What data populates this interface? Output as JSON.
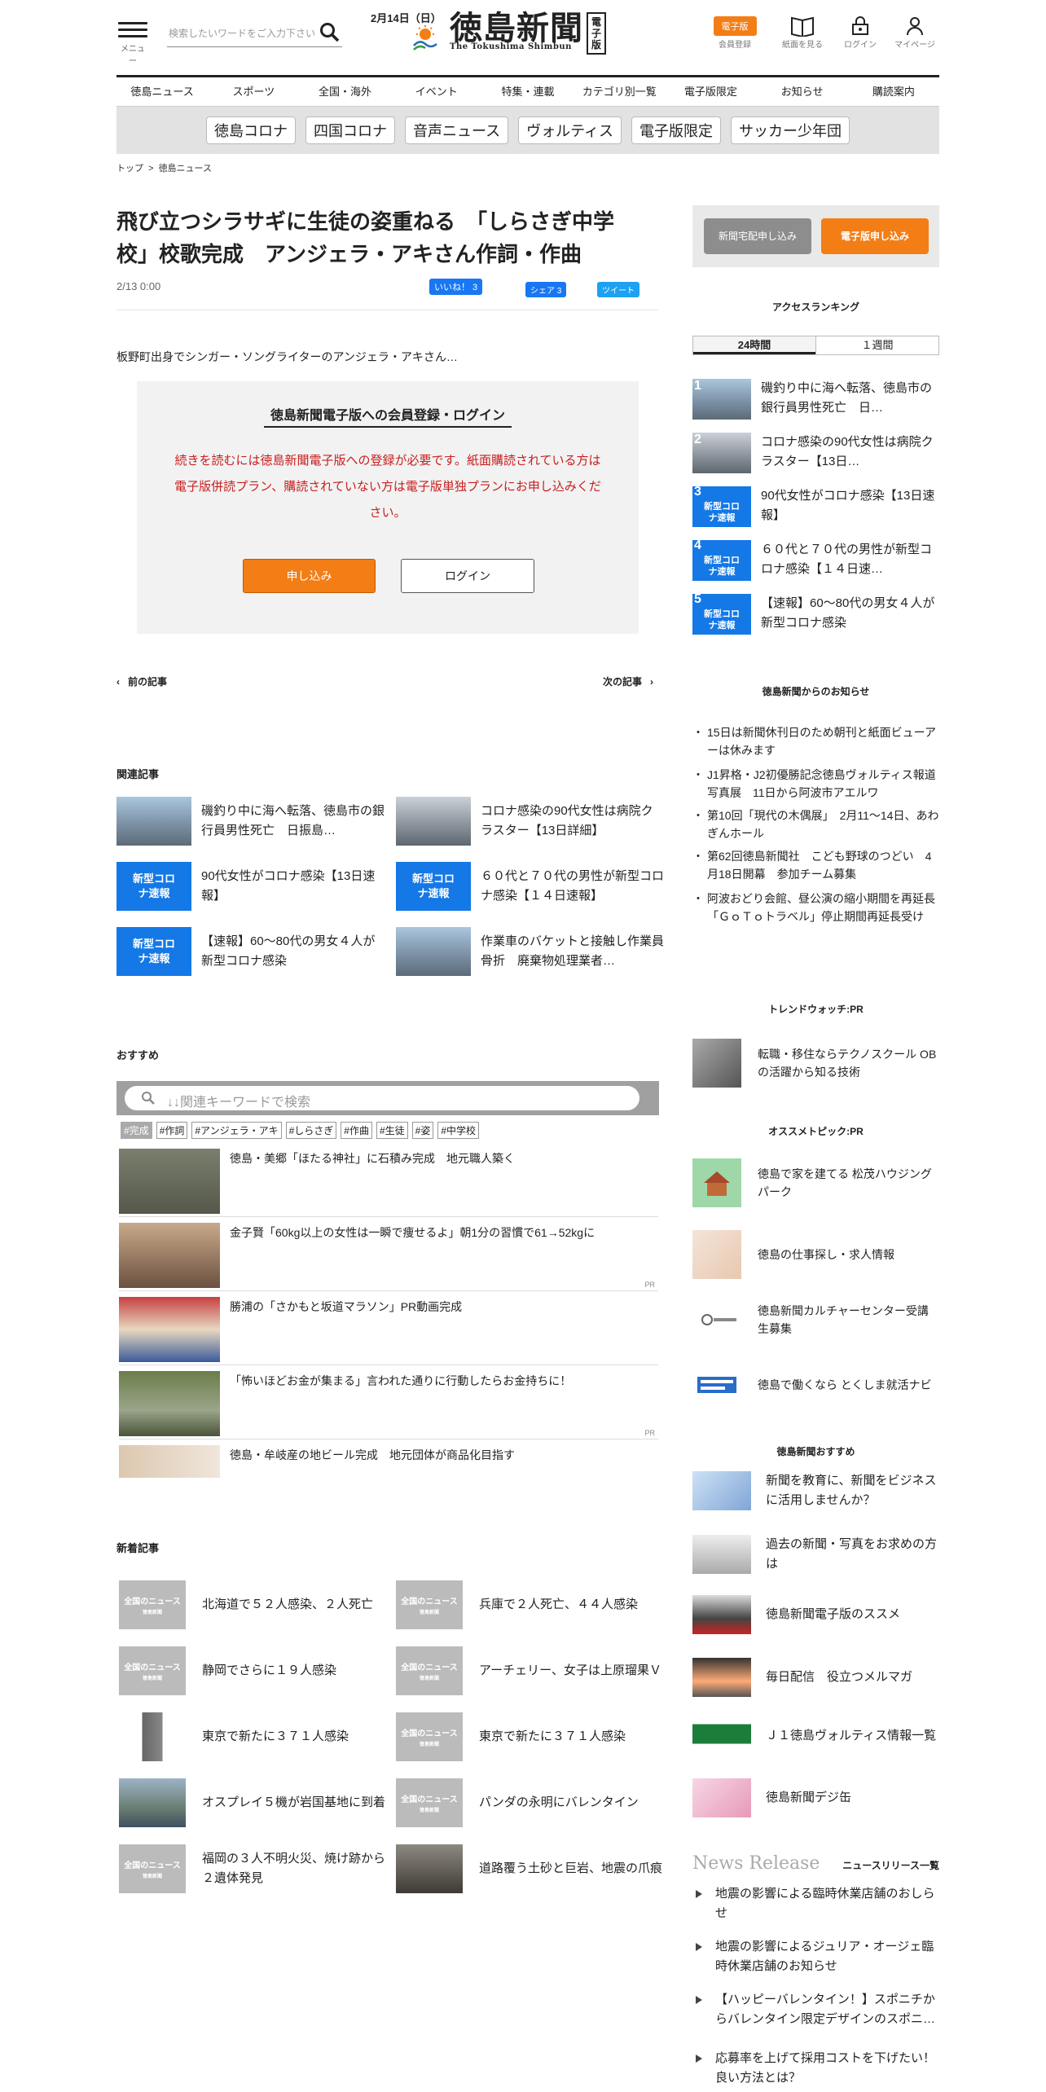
{
  "header": {
    "menu_label": "メニュー",
    "search_placeholder": "検索したいワードをご入力下さい",
    "date": "2月14日（日）",
    "logo": "徳島新聞",
    "logo_sub": "The Tokushima Shimbun",
    "logo_box": "電子版",
    "register_badge": "電子版",
    "register_label": "会員登録",
    "paper_label": "紙面を見る",
    "login_label": "ログイン",
    "mypage_label": "マイページ",
    "accent_color": "#f37e16"
  },
  "nav": [
    "徳島ニュース",
    "スポーツ",
    "全国・海外",
    "イベント",
    "特集・連載",
    "カテゴリ別一覧",
    "電子版限定",
    "お知らせ",
    "購読案内"
  ],
  "tags": [
    "徳島コロナ",
    "四国コロナ",
    "音声ニュース",
    "ヴォルティス",
    "電子版限定",
    "サッカー少年団"
  ],
  "breadcrumb": {
    "top": "トップ",
    "sep": ">",
    "current": "徳島ニュース"
  },
  "article": {
    "title": "飛び立つシラサギに生徒の姿重ねる　「しらさぎ中学校」校歌完成　アンジェラ・アキさん作詞・作曲",
    "datetime": "2/13 0:00",
    "like": "いいね！ 3",
    "share": "シェア 3",
    "tweet": "ツイート",
    "lead": "板野町出身でシンガー・ソングライターのアンジェラ・アキさん…"
  },
  "login_box": {
    "title": "徳島新聞電子版への会員登録・ログイン",
    "message": "続きを読むには徳島新聞電子版への登録が必要です。紙面購読されている方は電子版併読プラン、購読されていない方は電子版単独プランにお申し込みください。",
    "apply": "申し込み",
    "login": "ログイン"
  },
  "pager": {
    "prev": "前の記事",
    "next": "次の記事"
  },
  "related": {
    "heading": "関連記事",
    "items": [
      {
        "title": "磯釣り中に海へ転落、徳島市の銀行員男性死亡　日振島…",
        "thumb": "photo"
      },
      {
        "title": "コロナ感染の90代女性は病院クラスター【13日詳細】",
        "thumb": "photo2"
      },
      {
        "title": "90代女性がコロナ感染【13日速報】",
        "thumb": "corona"
      },
      {
        "title": "６０代と７０代の男性が新型コロナ感染【１４日速報】",
        "thumb": "corona"
      },
      {
        "title": "【速報】60～80代の男女４人が新型コロナ感染",
        "thumb": "corona"
      },
      {
        "title": "作業車のバケットと接触し作業員骨折　廃棄物処理業者…",
        "thumb": "photo"
      }
    ],
    "corona_label": "新型コロナ速報",
    "logo_overlay": "徳島新聞"
  },
  "recommend": {
    "heading": "おすすめ",
    "search_placeholder": "↓↓関連キーワードで検索",
    "chips": [
      "#完成",
      "#作詞",
      "#アンジェラ・アキ",
      "#しらさぎ",
      "#作曲",
      "#生徒",
      "#姿",
      "#中学校"
    ],
    "items": [
      {
        "title": "徳島・美郷「ほたる神社」に石積み完成　地元職人築く",
        "pr": ""
      },
      {
        "title": "金子賢「60kg以上の女性は一瞬で痩せるよ」朝1分の習慣で61→52kgに",
        "pr": "PR"
      },
      {
        "title": "勝浦の「さかもと坂道マラソン」PR動画完成",
        "pr": ""
      },
      {
        "title": "「怖いほどお金が集まる」言われた通りに行動したらお金持ちに！",
        "pr": "PR"
      },
      {
        "title": "徳島・牟岐産の地ビール完成　地元団体が商品化目指す",
        "pr": ""
      }
    ]
  },
  "newest": {
    "heading": "新着記事",
    "placeholder_label": "全国のニュース",
    "placeholder_sub": "徳島新聞",
    "items": [
      {
        "title": "北海道で５２人感染、２人死亡",
        "thumb": "gray"
      },
      {
        "title": "兵庫で２人死亡、４４人感染",
        "thumb": "gray"
      },
      {
        "title": "静岡でさらに１９人感染",
        "thumb": "gray"
      },
      {
        "title": "アーチェリー、女子は上原瑠果Ｖ",
        "thumb": "gray"
      },
      {
        "title": "東京で新たに３７１人感染",
        "thumb": "tower"
      },
      {
        "title": "東京で新たに３７１人感染",
        "thumb": "gray"
      },
      {
        "title": "オスプレイ５機が岩国基地に到着",
        "thumb": "aerial"
      },
      {
        "title": "パンダの永明にバレンタイン",
        "thumb": "gray"
      },
      {
        "title": "福岡の３人不明火災、焼け跡から２遺体発見",
        "thumb": "gray"
      },
      {
        "title": "道路覆う土砂と巨岩、地震の爪痕",
        "thumb": "rock"
      }
    ]
  },
  "sidebar": {
    "delivery_btn": "新聞宅配申し込み",
    "digital_btn": "電子版申し込み",
    "ranking_heading": "アクセスランキング",
    "tab_24h": "24時間",
    "tab_week": "１週間",
    "ranking": [
      {
        "rank": "1",
        "title": "磯釣り中に海へ転落、徳島市の銀行員男性死亡　日…",
        "thumb": "photo"
      },
      {
        "rank": "2",
        "title": "コロナ感染の90代女性は病院クラスター【13日…",
        "thumb": "photo2"
      },
      {
        "rank": "3",
        "title": "90代女性がコロナ感染【13日速報】",
        "thumb": "corona"
      },
      {
        "rank": "4",
        "title": "６０代と７０代の男性が新型コロナ感染【１４日速…",
        "thumb": "corona"
      },
      {
        "rank": "5",
        "title": "【速報】60～80代の男女４人が新型コロナ感染",
        "thumb": "corona"
      }
    ],
    "notice_heading": "徳島新聞からのお知らせ",
    "notices": [
      "15日は新聞休刊日のため朝刊と紙面ビューアーは休みます",
      "J1昇格・J2初優勝記念徳島ヴォルティス報道写真展　11日から阿波市アエルワ",
      "第10回「現代の木偶展」　2月11～14日、あわぎんホール",
      "第62回徳島新聞社　こども野球のつどい　4月18日開幕　参加チーム募集",
      "阿波おどり会館、昼公演の縮小期間を再延長「ＧｏＴｏトラベル」停止期間再延長受け"
    ],
    "trend_heading": "トレンドウォッチ:PR",
    "trend": [
      {
        "title": "転職・移住ならテクノスクール OBの活躍から知る技術"
      }
    ],
    "pick_heading": "オススメトピック:PR",
    "picks": [
      {
        "title": "徳島で家を建てる 松茂ハウジングパーク"
      },
      {
        "title": "徳島の仕事探し・求人情報"
      },
      {
        "title": "徳島新聞カルチャーセンター受講生募集"
      },
      {
        "title": "徳島で働くなら とくしま就活ナビ"
      }
    ],
    "recommend_heading": "徳島新聞おすすめ",
    "recommends": [
      {
        "title": "新聞を教育に、新聞をビジネスに活用しませんか？"
      },
      {
        "title": "過去の新聞・写真をお求めの方は"
      },
      {
        "title": "徳島新聞電子版のススメ"
      },
      {
        "title": "毎日配信　役立つメルマガ"
      },
      {
        "title": "Ｊ１徳島ヴォルティス情報一覧"
      },
      {
        "title": "徳島新聞デジ缶"
      }
    ],
    "news_release_title": "News Release",
    "news_release_link": "ニュースリリース一覧",
    "releases": [
      "地震の影響による臨時休業店舗のおしらせ",
      "地震の影響によるジュリア・オージェ臨時休業店舗のお知らせ",
      "【ハッピーバレンタイン！】スポニチからバレンタイン限定デザインのスポニ…",
      "応募率を上げて採用コストを下げたい！良い方法とは？"
    ]
  }
}
